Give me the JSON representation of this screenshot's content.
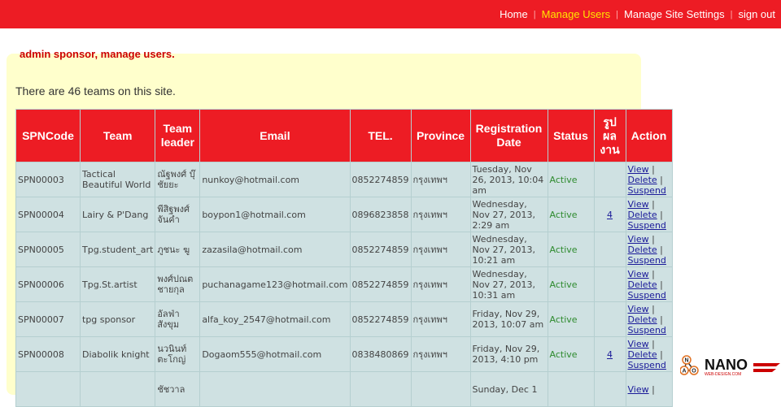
{
  "nav": {
    "items": [
      {
        "label": "Home",
        "active": false
      },
      {
        "label": "Manage Users",
        "active": true
      },
      {
        "label": "Manage Site Settings",
        "active": false
      },
      {
        "label": "sign out",
        "active": false
      }
    ],
    "separator": "|"
  },
  "page": {
    "heading": "admin sponsor, manage users.",
    "count_text": "There are 46 teams on this site."
  },
  "table": {
    "headers": [
      "SPNCode",
      "Team",
      "Team leader",
      "Email",
      "TEL.",
      "Province",
      "Registration Date",
      "Status",
      "รูป ผล งาน",
      "Action"
    ],
    "actions": {
      "view": "View",
      "delete": "Delete",
      "suspend": "Suspend",
      "sep": "|"
    },
    "rows": [
      {
        "code": "SPN00003",
        "team": "Tactical Beautiful World",
        "leader": "ณัฐพงศ์ บุ๊ชัยยะ",
        "email": "nunkoy@hotmail.com",
        "tel": "0852274859",
        "province": "กรุงเทพฯ",
        "date": "Tuesday, Nov 26, 2013, 10:04 am",
        "status": "Active",
        "works": ""
      },
      {
        "code": "SPN00004",
        "team": "Lairy & P'Dang",
        "leader": "พีสิฐพงศ์ จันคำ",
        "email": "boypon1@hotmail.com",
        "tel": "0896823858",
        "province": "กรุงเทพฯ",
        "date": "Wednesday, Nov 27, 2013, 2:29 am",
        "status": "Active",
        "works": "4"
      },
      {
        "code": "SPN00005",
        "team": "Tpg.student_art",
        "leader": "ภูชนะ ฆู",
        "email": "zazasila@hotmail.com",
        "tel": "0852274859",
        "province": "กรุงเทพฯ",
        "date": "Wednesday, Nov 27, 2013, 10:21 am",
        "status": "Active",
        "works": ""
      },
      {
        "code": "SPN00006",
        "team": "Tpg.St.artist",
        "leader": "พงศ์ปณต ชายกุล",
        "email": "puchanagame123@hotmail.com",
        "tel": "0852274859",
        "province": "กรุงเทพฯ",
        "date": "Wednesday, Nov 27, 2013, 10:31 am",
        "status": "Active",
        "works": ""
      },
      {
        "code": "SPN00007",
        "team": "tpg sponsor",
        "leader": "อัลฟ่า สังขุม",
        "email": "alfa_koy_2547@hotmail.com",
        "tel": "0852274859",
        "province": "กรุงเทพฯ",
        "date": "Friday, Nov 29, 2013, 10:07 am",
        "status": "Active",
        "works": ""
      },
      {
        "code": "SPN00008",
        "team": "Diabolik knight",
        "leader": "นวนินท์ ตะโกญ่",
        "email": "Dogaom555@hotmail.com",
        "tel": "0838480869",
        "province": "กรุงเทพฯ",
        "date": "Friday, Nov 29, 2013, 4:10 pm",
        "status": "Active",
        "works": "4"
      },
      {
        "code": "",
        "team": "",
        "leader": "ชัชวาล",
        "email": "",
        "tel": "",
        "province": "",
        "date": "Sunday, Dec 1",
        "status": "",
        "works": ""
      }
    ]
  },
  "logo": {
    "text": "NANO",
    "sub": "WEB-DESIGN.COM",
    "letters": [
      "N",
      "A",
      "O"
    ]
  }
}
